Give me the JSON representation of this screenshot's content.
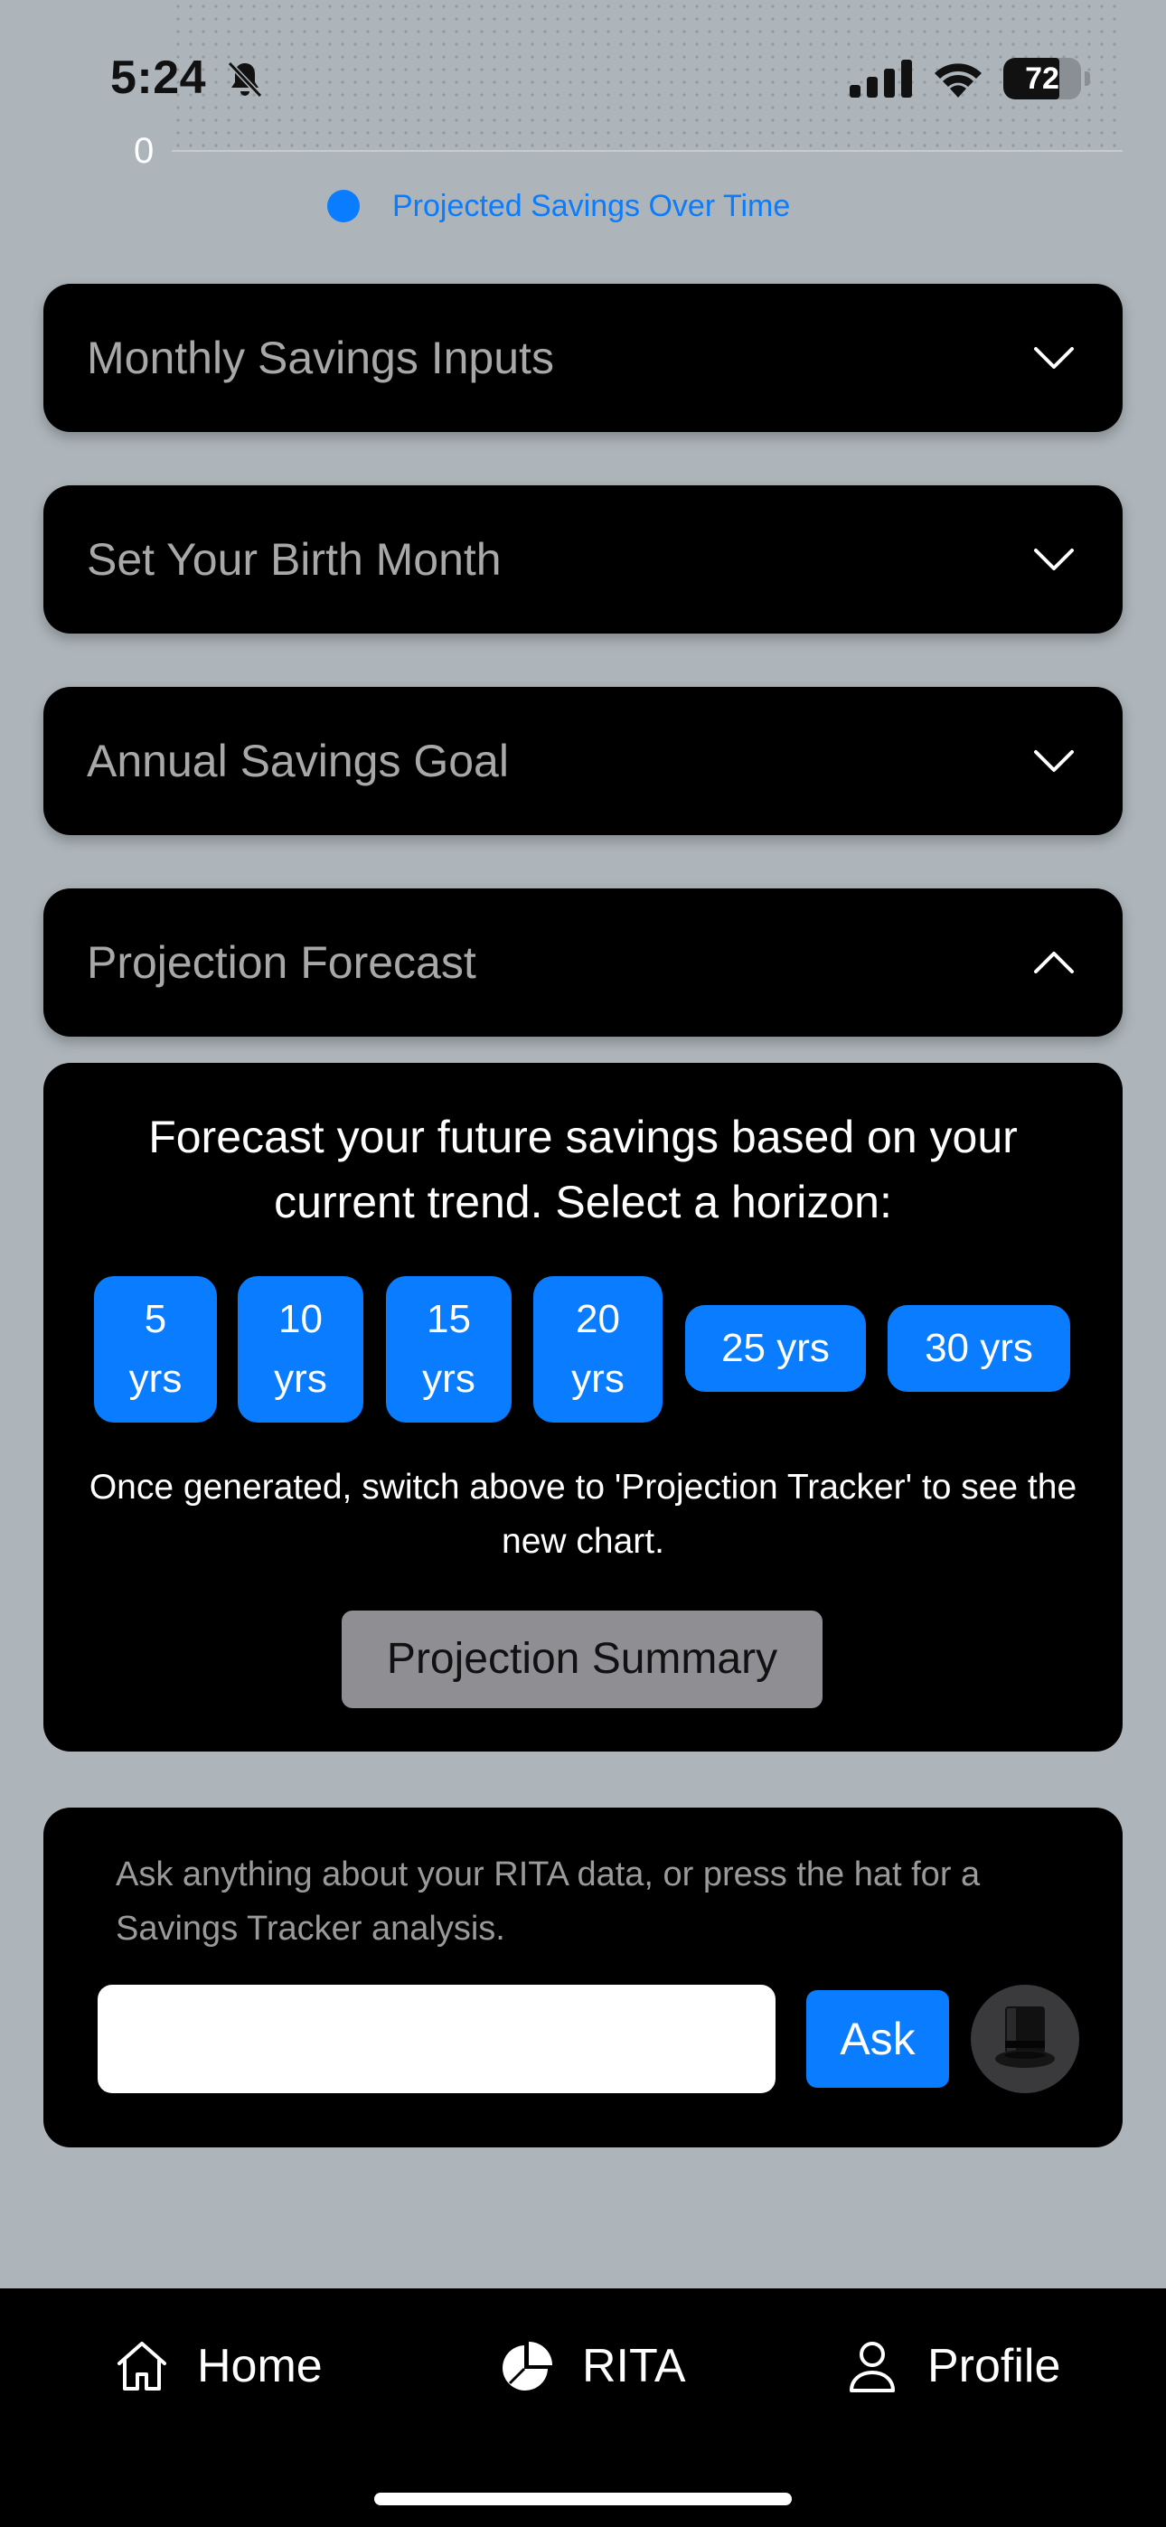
{
  "status_bar": {
    "time": "5:24",
    "battery_level": "72",
    "battery_fraction": 0.72,
    "icons": [
      "bell-slash-icon",
      "signal-icon",
      "wifi-icon",
      "battery-icon"
    ]
  },
  "chart": {
    "zero_label": "0",
    "legend_label": "Projected Savings Over Time",
    "legend_color": "#0a7cff"
  },
  "accordions": [
    {
      "title": "Monthly Savings Inputs",
      "expanded": false
    },
    {
      "title": "Set Your Birth Month",
      "expanded": false
    },
    {
      "title": "Annual Savings Goal",
      "expanded": false
    },
    {
      "title": "Projection Forecast",
      "expanded": true
    }
  ],
  "forecast": {
    "intro": "Forecast your future savings based on your current trend. Select a horizon:",
    "horizons": [
      {
        "number": "5",
        "unit": "yrs"
      },
      {
        "number": "10",
        "unit": "yrs"
      },
      {
        "number": "15",
        "unit": "yrs"
      },
      {
        "number": "20",
        "unit": "yrs"
      },
      {
        "label": "25 yrs"
      },
      {
        "label": "30 yrs"
      }
    ],
    "note": "Once generated, switch above to 'Projection Tracker' to see the new chart.",
    "summary_button": "Projection Summary"
  },
  "ask": {
    "hint": "Ask anything about your RITA data, or press the hat for a Savings Tracker analysis.",
    "input_value": "",
    "input_placeholder": "",
    "ask_button": "Ask",
    "hat_icon": "top-hat-icon"
  },
  "tab_bar": {
    "items": [
      {
        "label": "Home",
        "icon": "house-icon"
      },
      {
        "label": "RITA",
        "icon": "pie-chart-icon"
      },
      {
        "label": "Profile",
        "icon": "person-icon"
      }
    ]
  },
  "colors": {
    "accent": "#0a7cff",
    "background": "#adb5ba",
    "card": "#000000",
    "muted_button": "#8e8e93"
  }
}
